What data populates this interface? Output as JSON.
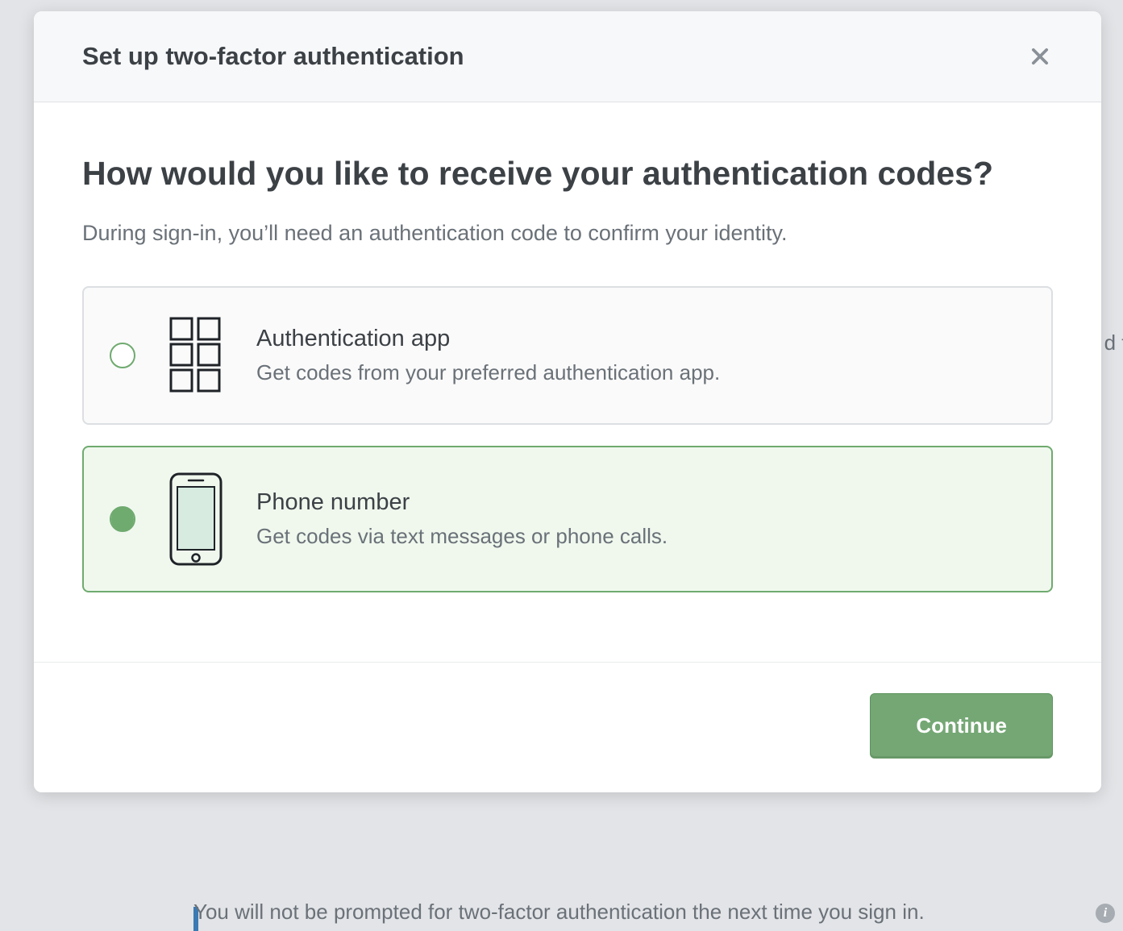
{
  "backdrop": {
    "right_fragment": "d to",
    "bottom_note": "You will not be prompted for two-factor authentication the next time you sign in.",
    "info_glyph": "i"
  },
  "modal": {
    "title": "Set up two-factor authentication",
    "heading": "How would you like to receive your authentication codes?",
    "subtext": "During sign-in, you’ll need an authentication code to confirm your identity.",
    "options": [
      {
        "title": "Authentication app",
        "desc": "Get codes from your preferred authentication app.",
        "selected": false
      },
      {
        "title": "Phone number",
        "desc": "Get codes via text messages or phone calls.",
        "selected": true
      }
    ],
    "continue_label": "Continue"
  }
}
